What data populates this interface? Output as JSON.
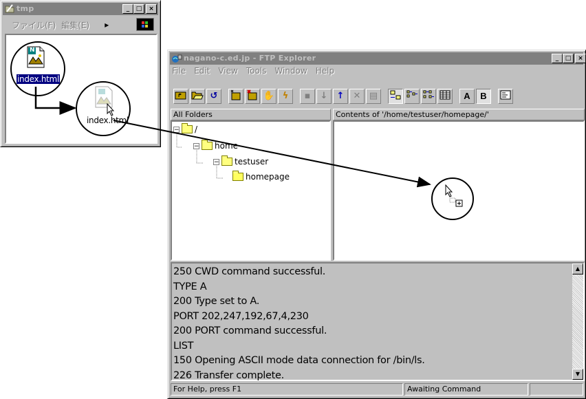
{
  "tmp_window": {
    "title": "tmp",
    "menu_left": "ファイル(F)",
    "menu_right": "編集(E)",
    "menu_more": "▸",
    "file_label": "index.html",
    "drag_label": "index.html",
    "file_badge": "N"
  },
  "ftp_window": {
    "title": "nagano-c.ed.jp - FTP Explorer",
    "menu": [
      "File",
      "Edit",
      "View",
      "Tools",
      "Window",
      "Help"
    ],
    "toolbar": {
      "bold_a": "A",
      "bold_b": "B"
    },
    "folders_header": "All Folders",
    "contents_header": "Contents of '/home/testuser/homepage/'",
    "tree": [
      {
        "label": "/",
        "expander": "−"
      },
      {
        "label": "home",
        "expander": "−"
      },
      {
        "label": "testuser",
        "expander": "−"
      },
      {
        "label": "homepage",
        "expander": ""
      }
    ],
    "log": [
      "250 CWD command successful.",
      "TYPE A",
      "200 Type set to A.",
      "PORT 202,247,192,67,4,230",
      "200 PORT command successful.",
      "LIST",
      "150 Opening ASCII mode data connection for /bin/ls.",
      "226 Transfer complete."
    ],
    "status_left": "For Help, press F1",
    "status_right": "Awaiting Command"
  },
  "colors": {
    "inactive_title": "#808080",
    "face": "#c0c0c0",
    "folder": "#ffff80"
  },
  "icons": [
    "tmp-folder-icon",
    "windows-logo-icon",
    "html-file-icon",
    "ftp-app-icon",
    "drag-copy-cursor-icon"
  ]
}
